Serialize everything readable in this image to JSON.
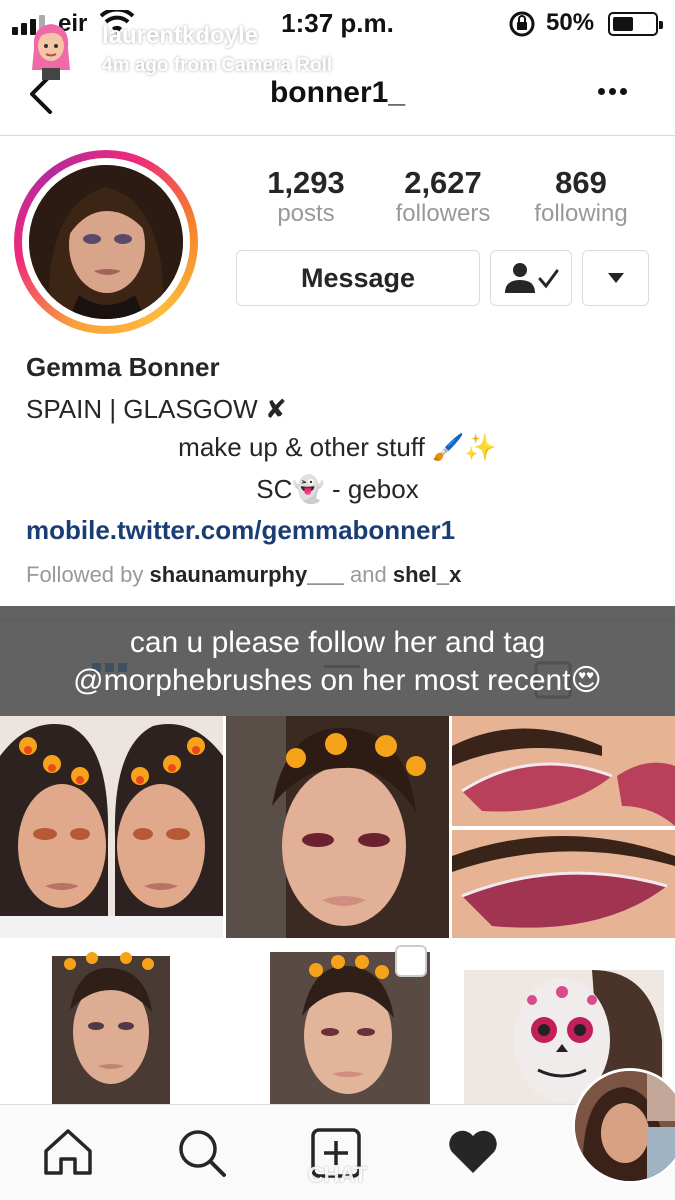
{
  "status_bar": {
    "carrier": "eir",
    "time": "1:37 p.m.",
    "battery_percent": "50%",
    "battery_level": 0.5
  },
  "snap_overlay": {
    "username": "laurentkdoyle",
    "meta": "4m ago from Camera Roll",
    "caption_line1": "can u please follow her and tag",
    "caption_line2": "@morphebrushes on her most recent😍",
    "chat_label": "CHAT"
  },
  "nav": {
    "title": "bonner1_"
  },
  "profile": {
    "stats": [
      {
        "value": "1,293",
        "label": "posts"
      },
      {
        "value": "2,627",
        "label": "followers"
      },
      {
        "value": "869",
        "label": "following"
      }
    ],
    "message_label": "Message"
  },
  "bio": {
    "name": "Gemma Bonner",
    "line1": "SPAIN | GLASGOW ✘",
    "line2": "make up & other stuff 🖌️✨",
    "line3": "SC👻 - gebox",
    "link": "mobile.twitter.com/gemmabonner1",
    "followed_prefix": "Followed by ",
    "followed_user1": "shaunamurphy___",
    "followed_and": " and ",
    "followed_user2": "shel_x"
  },
  "icons": {
    "back": "chevron-left-icon",
    "more": "more-dots-icon",
    "following": "user-check-icon",
    "dropdown": "caret-down-icon",
    "home": "home-icon",
    "search": "search-icon",
    "add": "add-post-icon",
    "activity": "heart-icon"
  },
  "colors": {
    "link": "#1a3e73",
    "muted": "#999999",
    "border": "#dbdbdb",
    "ring_start": "#f58529",
    "ring_end": "#b52a9d"
  }
}
